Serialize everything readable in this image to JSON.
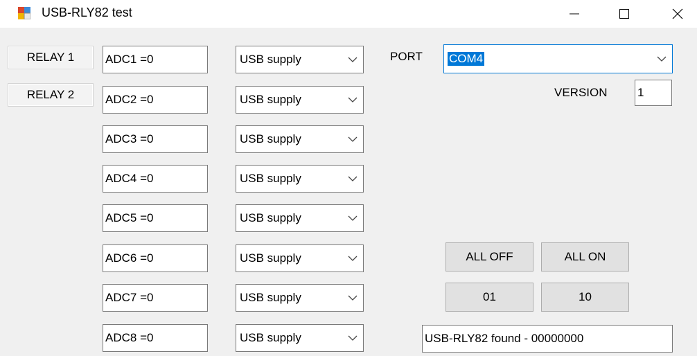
{
  "window": {
    "title": "USB-RLY82 test"
  },
  "relays": [
    {
      "label": "RELAY 1"
    },
    {
      "label": "RELAY 2"
    }
  ],
  "adc": [
    {
      "value": "ADC1 =0",
      "supply": "USB supply"
    },
    {
      "value": "ADC2 =0",
      "supply": "USB supply"
    },
    {
      "value": "ADC3 =0",
      "supply": "USB supply"
    },
    {
      "value": "ADC4 =0",
      "supply": "USB supply"
    },
    {
      "value": "ADC5 =0",
      "supply": "USB supply"
    },
    {
      "value": "ADC6 =0",
      "supply": "USB supply"
    },
    {
      "value": "ADC7 =0",
      "supply": "USB supply"
    },
    {
      "value": "ADC8 =0",
      "supply": "USB supply"
    }
  ],
  "port": {
    "label": "PORT",
    "value": "COM4"
  },
  "version": {
    "label": "VERSION",
    "value": "1"
  },
  "buttons": {
    "all_off": "ALL OFF",
    "all_on": "ALL ON",
    "b01": "01",
    "b10": "10"
  },
  "status": "USB-RLY82 found - 00000000",
  "icons": {
    "app": "app-window-icon",
    "minimize": "minimize-icon",
    "maximize": "maximize-icon",
    "close": "close-icon",
    "dropdown": "chevron-down-icon"
  },
  "colors": {
    "selection": "#0078d7",
    "window_bg": "#f0f0f0",
    "button_bg": "#e1e1e1"
  }
}
